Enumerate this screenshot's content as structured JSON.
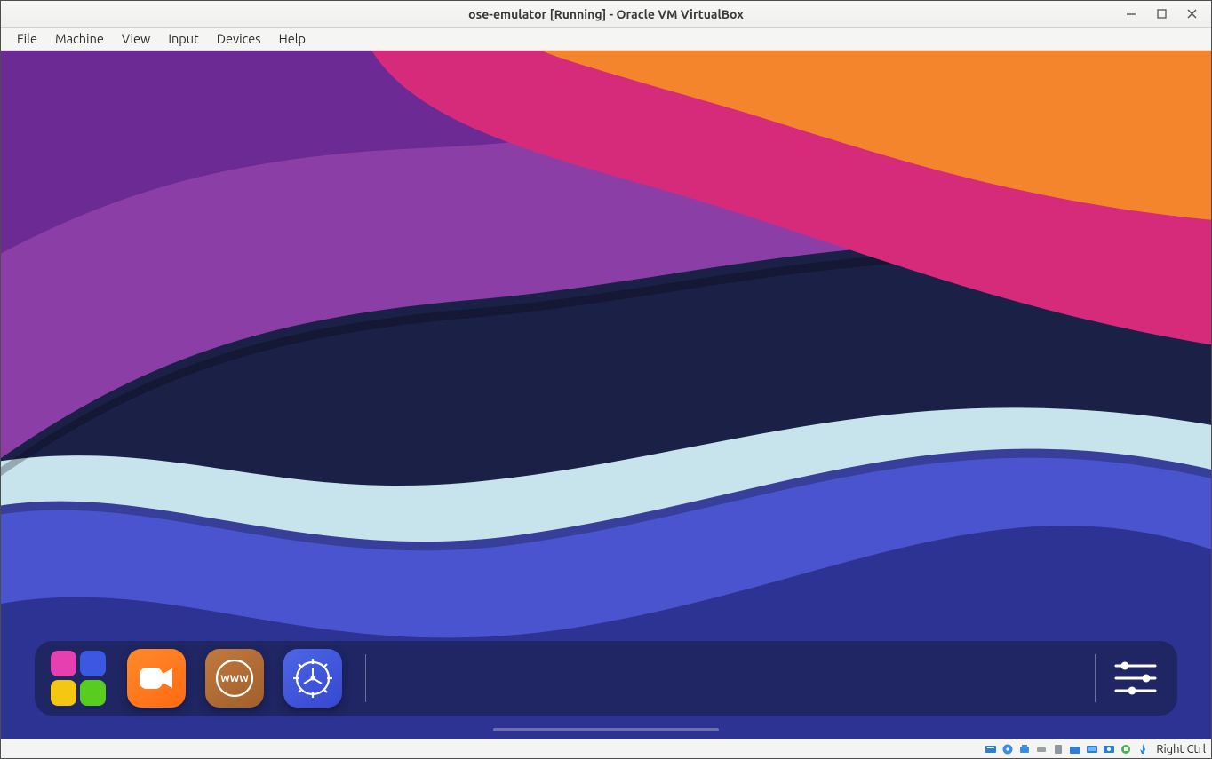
{
  "window": {
    "title": "ose-emulator [Running] - Oracle VM VirtualBox",
    "controls": {
      "minimize": "−",
      "maximize": "□",
      "close": "✕"
    }
  },
  "menubar": {
    "items": [
      "File",
      "Machine",
      "View",
      "Input",
      "Devices",
      "Help"
    ]
  },
  "guest": {
    "dock": {
      "apps": [
        {
          "name": "launcher-app-icon"
        },
        {
          "name": "camera-app-icon"
        },
        {
          "name": "browser-app-icon"
        },
        {
          "name": "settings-app-icon"
        }
      ],
      "quick": {
        "name": "quick-settings-icon"
      }
    }
  },
  "statusbar": {
    "icons": [
      "hard-disk-icon",
      "optical-disk-icon",
      "audio-icon",
      "network-icon",
      "usb-icon",
      "shared-folder-icon",
      "display-icon",
      "recording-icon",
      "cpu-icon",
      "mouse-integration-icon"
    ],
    "host_key": "Right Ctrl"
  }
}
